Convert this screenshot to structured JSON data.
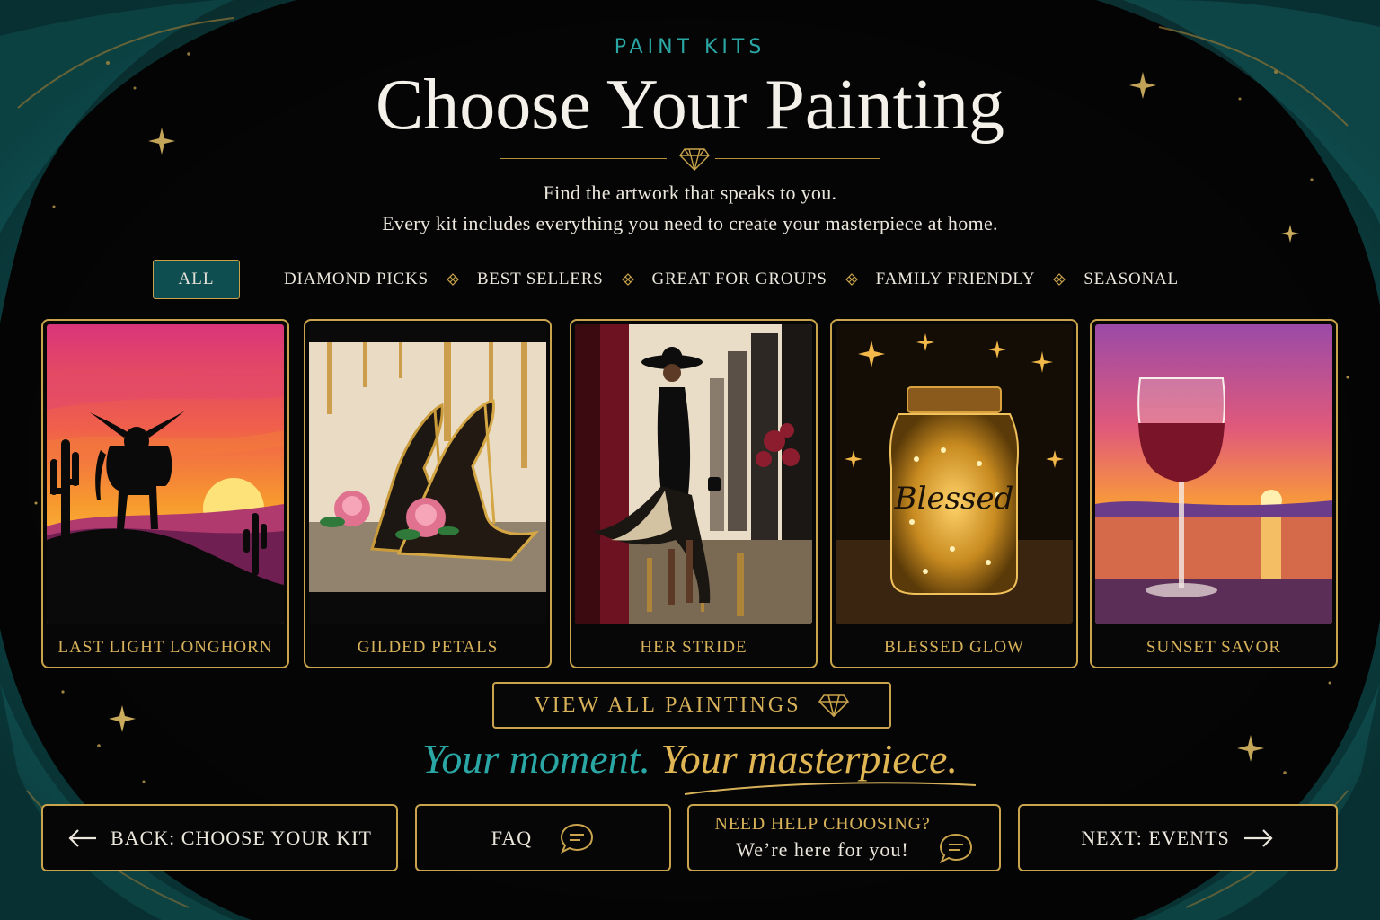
{
  "header": {
    "eyebrow": "PAINT KITS",
    "title": "Choose Your Painting",
    "subtitle_line1": "Find the artwork that speaks to you.",
    "subtitle_line2": "Every kit includes everything you need to create your masterpiece at home."
  },
  "filters": {
    "active": "ALL",
    "items": [
      "DIAMOND PICKS",
      "BEST SELLERS",
      "GREAT FOR GROUPS",
      "FAMILY FRIENDLY",
      "SEASONAL"
    ]
  },
  "paintings": [
    {
      "title": "LAST LIGHT LONGHORN"
    },
    {
      "title": "GILDED PETALS"
    },
    {
      "title": "HER STRIDE"
    },
    {
      "title": "BLESSED GLOW",
      "jar_text": "Blessed"
    },
    {
      "title": "SUNSET SAVOR"
    }
  ],
  "view_all_label": "VIEW ALL PAINTINGS",
  "tagline": {
    "part1": "Your moment.",
    "part2": "Your masterpiece."
  },
  "footer_nav": {
    "back_label": "BACK: CHOOSE YOUR KIT",
    "faq_label": "FAQ",
    "help_title": "NEED HELP CHOOSING?",
    "help_sub": "We’re here for you!",
    "next_label": "NEXT: EVENTS"
  },
  "colors": {
    "accent_gold": "#caa44c",
    "accent_teal": "#2aa7a4",
    "background": "#050505"
  },
  "icons": [
    "diamond-icon",
    "arrow-left-icon",
    "arrow-right-icon",
    "chat-bubble-icon",
    "sparkle-icon"
  ]
}
